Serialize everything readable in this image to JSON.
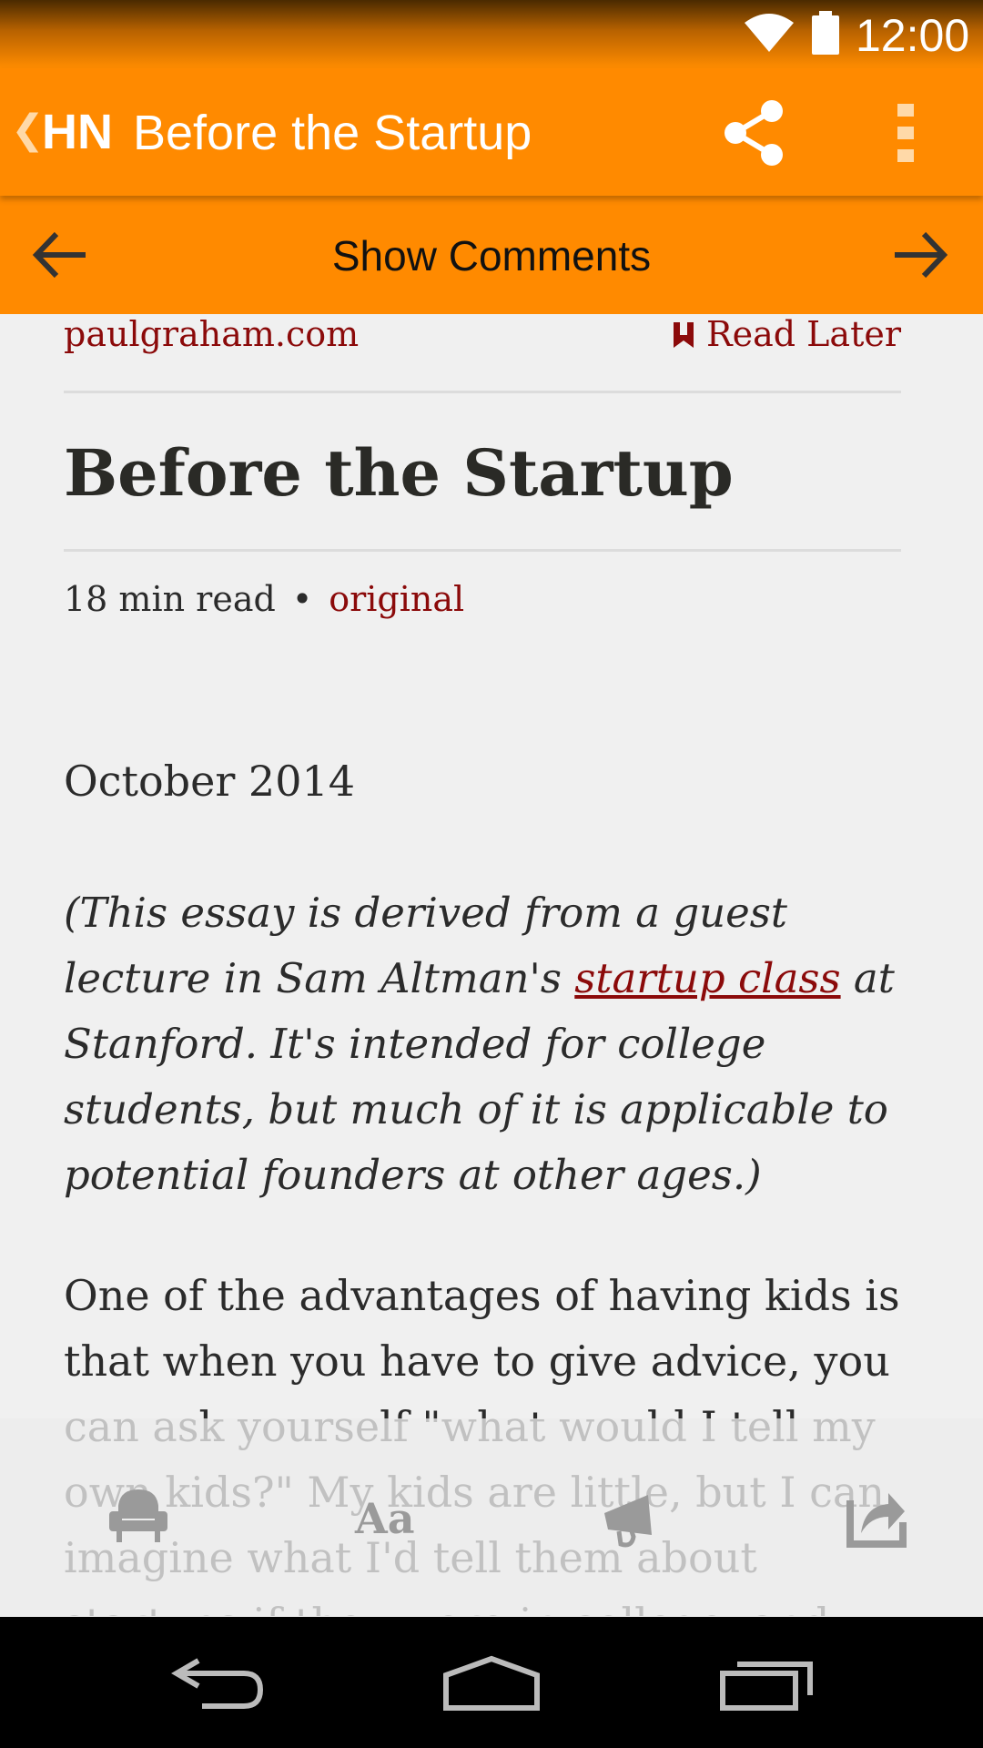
{
  "status_bar": {
    "time": "12:00",
    "icons": [
      "wifi-icon",
      "battery-icon"
    ]
  },
  "action_bar": {
    "app_logo": "HN",
    "title": "Before the Startup",
    "icons": [
      "back-chevron-icon",
      "share-icon",
      "overflow-menu-icon"
    ]
  },
  "comments_bar": {
    "label": "Show Comments",
    "icons": [
      "arrow-left-icon",
      "arrow-right-icon"
    ]
  },
  "article": {
    "domain": "paulgraham.com",
    "read_later": "Read Later",
    "headline": "Before the Startup",
    "read_time": "18 min read",
    "separator": "•",
    "original_link": "original",
    "date": "October 2014",
    "intro_before_link": "(This essay is derived from a guest lecture in Sam Altman's ",
    "intro_link": "startup class",
    "intro_after_link": " at Stanford. It's intended for college students, but much of it is applicable to potential founders at other ages.)",
    "body": "One of the advantages of having kids is that when you have to give advice, you can ask yourself \"what would I tell my own kids?\" My kids are little, but I can imagine what I'd tell them about startups if they were in college, and"
  },
  "toolbar": {
    "font_size_label": "Aa",
    "icons": [
      "armchair-icon",
      "font-size-icon",
      "megaphone-icon",
      "share-out-icon"
    ]
  },
  "colors": {
    "accent": "#ff8a00",
    "link": "#8b0a0a",
    "background": "#f0f0f0"
  }
}
